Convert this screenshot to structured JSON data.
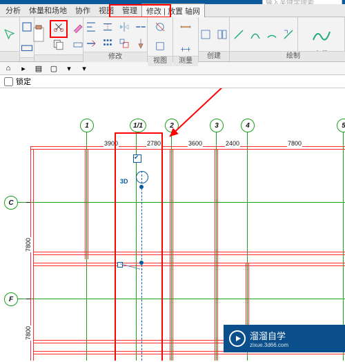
{
  "menubar": {
    "items": [
      "分析",
      "体量和场地",
      "协作",
      "视图",
      "管理",
      "修改 | 放置 轴网"
    ],
    "active_index": 5
  },
  "search_placeholder": "输入关键字搜索",
  "ribbon": {
    "groups": [
      {
        "label": ""
      },
      {
        "label": ""
      },
      {
        "label": ""
      },
      {
        "label": "修改"
      },
      {
        "label": "视图"
      },
      {
        "label": "测量"
      },
      {
        "label": "创建"
      },
      {
        "label": ""
      },
      {
        "label": "多段",
        "sub": "绘制"
      }
    ]
  },
  "lock_label": "锁定",
  "grid": {
    "v_labels": [
      "1",
      "1/1",
      "2",
      "3",
      "4",
      "5"
    ],
    "h_labels": [
      "C",
      "F"
    ],
    "dims_top": [
      "3900",
      "2780",
      "3600",
      "2400",
      "7800"
    ],
    "dims_left": [
      "7800",
      "7800"
    ],
    "marker_3d": "3D"
  },
  "watermark": {
    "brand": "溜溜自学",
    "url": "zixue.3d66.com"
  }
}
